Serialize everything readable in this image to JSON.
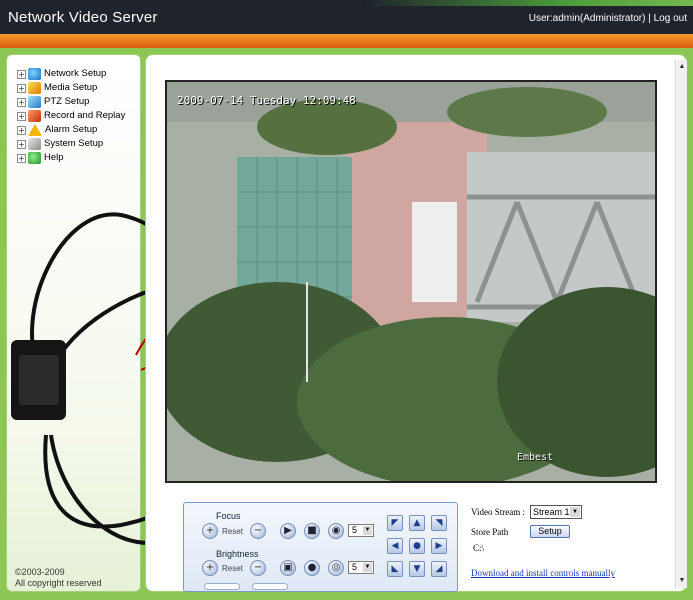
{
  "header": {
    "title": "Network Video Server",
    "user_info": "User:admin(Administrator)",
    "separator": " | ",
    "logout_label": "Log out"
  },
  "sidebar": {
    "items": [
      {
        "label": "Network Setup",
        "icon": "globe-icon"
      },
      {
        "label": "Media Setup",
        "icon": "media-icon"
      },
      {
        "label": "PTZ Setup",
        "icon": "ptz-icon"
      },
      {
        "label": "Record and Replay",
        "icon": "record-icon"
      },
      {
        "label": "Alarm Setup",
        "icon": "alarm-icon"
      },
      {
        "label": "System Setup",
        "icon": "system-icon"
      },
      {
        "label": "Help",
        "icon": "help-icon"
      }
    ],
    "copyright_line1": "©2003-2009",
    "copyright_line2": "All copyright reserved"
  },
  "video": {
    "timestamp": "2009-07-14 Tuesday 12:09:48",
    "watermark": "Embest"
  },
  "ptz": {
    "focus_label": "Focus",
    "brightness_label": "Brightness",
    "reset_label": "Reset",
    "focus_speed": "5",
    "brightness_speed": "5"
  },
  "stream": {
    "label": "Video Stream :",
    "selected": "Stream 1",
    "store_path_label": "Store Path",
    "setup_label": "Setup",
    "store_path_value": "C:\\",
    "download_link": "Download and install controls manually"
  },
  "colors": {
    "header_bg": "#1f232b",
    "accent_orange": "#e8731a",
    "frame_green": "#8cc653",
    "link_blue": "#1a35b8"
  }
}
